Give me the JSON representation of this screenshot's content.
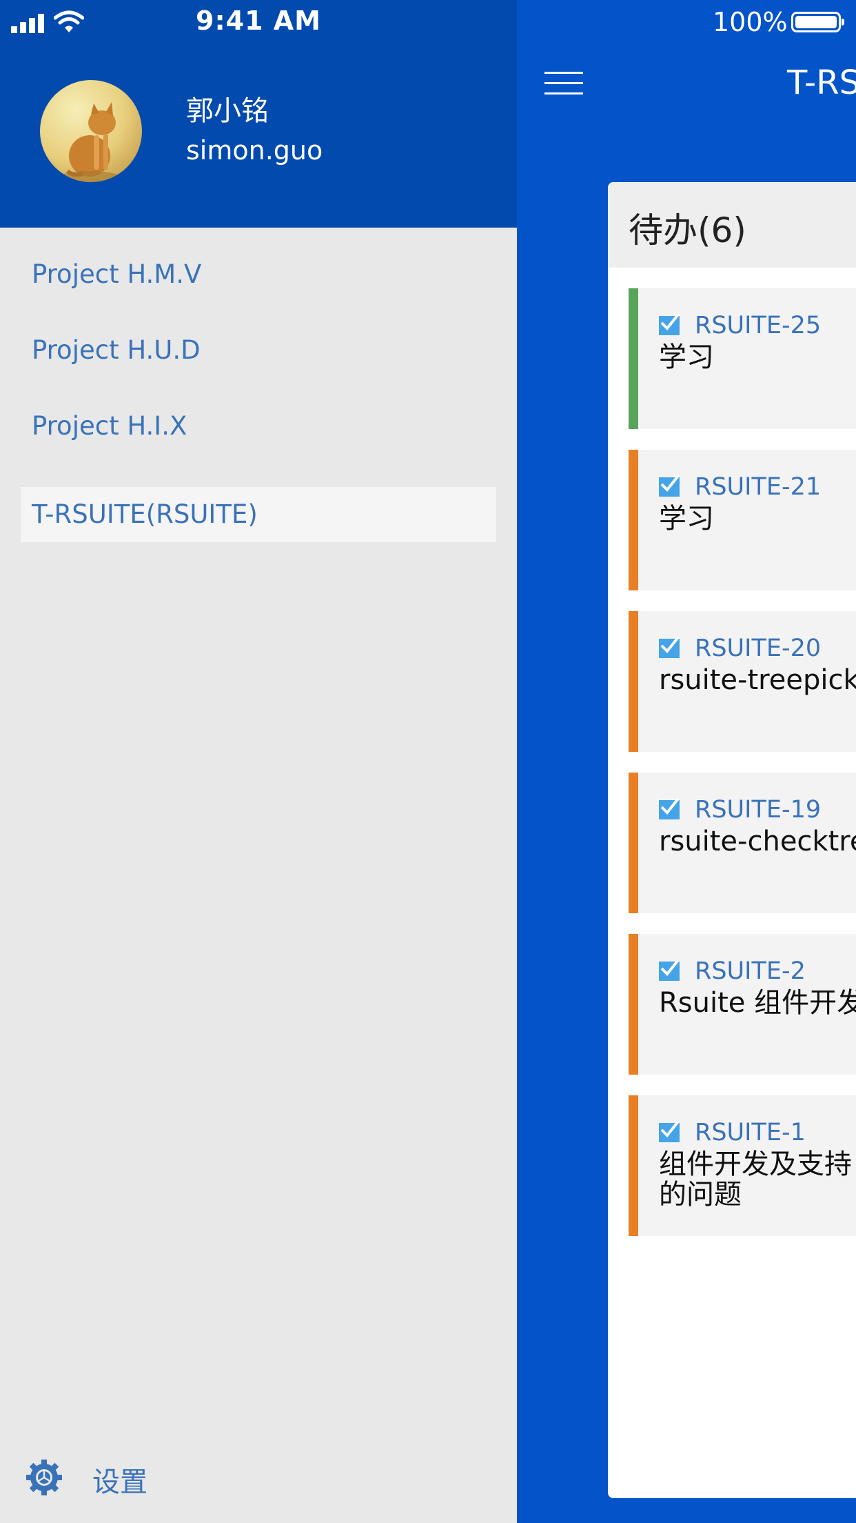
{
  "status_bar": {
    "time": "9:41 AM",
    "battery": "100%",
    "signal_icon": "cellular-signal-icon",
    "wifi_icon": "wifi-icon",
    "battery_icon": "battery-icon"
  },
  "drawer": {
    "user": {
      "name": "郭小铭",
      "username": "simon.guo",
      "avatar_icon": "cat-avatar"
    },
    "projects": [
      {
        "label": "Project H.M.V",
        "active": false
      },
      {
        "label": "Project H.U.D",
        "active": false
      },
      {
        "label": "Project H.I.X",
        "active": false
      },
      {
        "label": "T-RSUITE(RSUITE)",
        "active": true
      }
    ],
    "settings": {
      "label": "设置",
      "icon": "gear-icon"
    }
  },
  "main": {
    "menu_icon": "hamburger-menu-icon",
    "title": "T-RS",
    "board": {
      "title": "待办(6)",
      "tasks": [
        {
          "id": "RSUITE-25",
          "text": [
            "学习"
          ],
          "status_color": "#57a55a"
        },
        {
          "id": "RSUITE-21",
          "text": [
            "学习"
          ],
          "status_color": "#e87f24"
        },
        {
          "id": "RSUITE-20",
          "text": [
            "rsuite-treepicke"
          ],
          "status_color": "#e87f24"
        },
        {
          "id": "RSUITE-19",
          "text": [
            "rsuite-checktre"
          ],
          "status_color": "#e87f24"
        },
        {
          "id": "RSUITE-2",
          "text": [
            "Rsuite 组件开发"
          ],
          "status_color": "#e87f24"
        },
        {
          "id": "RSUITE-1",
          "text": [
            "组件开发及支持",
            "的问题"
          ],
          "status_color": "#e87f24"
        }
      ]
    }
  },
  "colors": {
    "primary": "#0254c8",
    "header_dark": "#034aaf",
    "link": "#3a72b8",
    "task_icon": "#45a4e8"
  }
}
